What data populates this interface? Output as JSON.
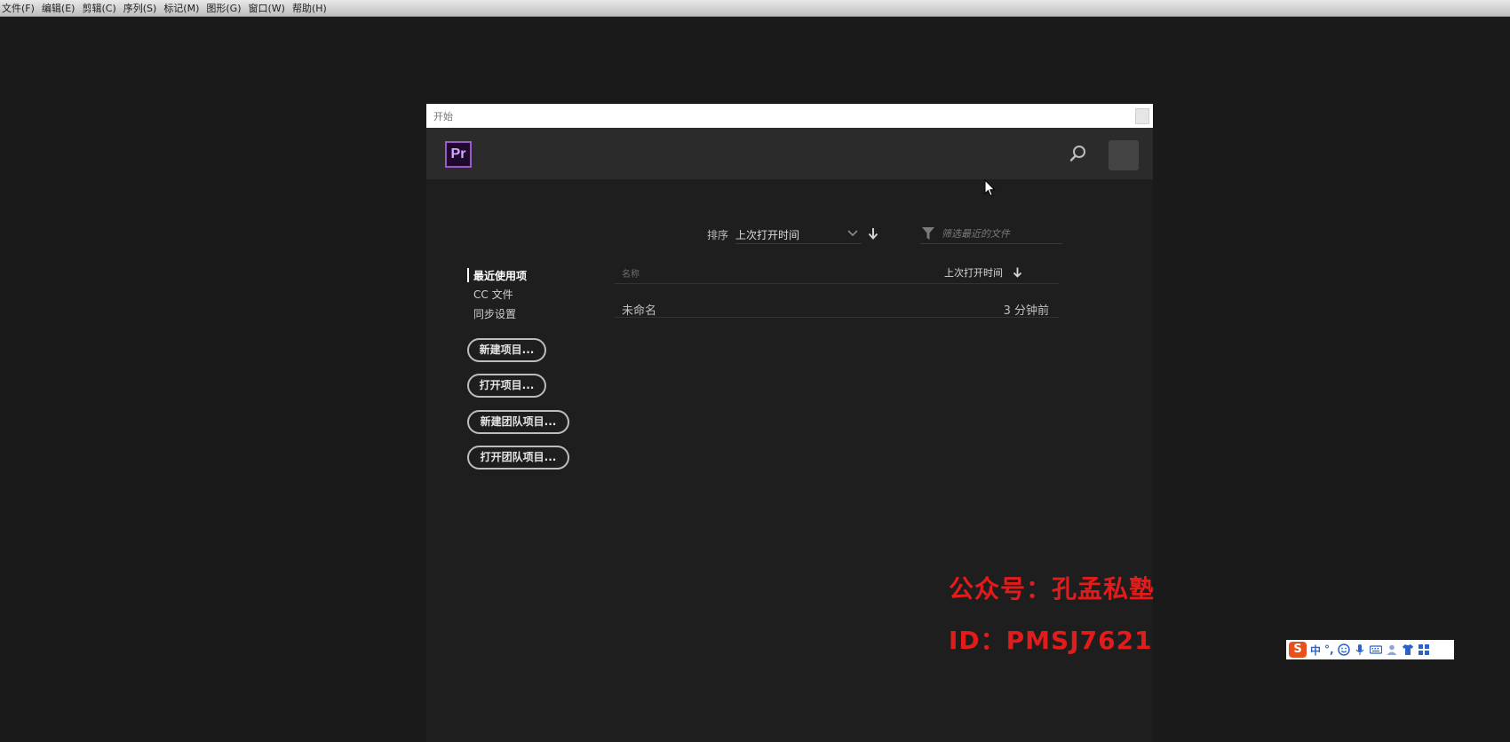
{
  "menubar": {
    "items": [
      "文件(F)",
      "编辑(E)",
      "剪辑(C)",
      "序列(S)",
      "标记(M)",
      "图形(G)",
      "窗口(W)",
      "帮助(H)"
    ]
  },
  "dialog": {
    "title": "开始",
    "logo_text": "Pr",
    "sort": {
      "label": "排序",
      "value": "上次打开时间"
    },
    "filter": {
      "placeholder": "筛选最近的文件"
    },
    "nav": {
      "items": [
        "最近使用项",
        "CC 文件",
        "同步设置"
      ],
      "active_index": 0
    },
    "buttons": {
      "new_project": "新建项目...",
      "open_project": "打开项目...",
      "new_team_project": "新建团队项目...",
      "open_team_project": "打开团队项目..."
    },
    "table": {
      "columns": [
        "名称",
        "上次打开时间"
      ],
      "rows": [
        {
          "name": "未命名",
          "opened": "3 分钟前"
        }
      ]
    }
  },
  "watermark": {
    "line1": "公众号：孔孟私塾",
    "line2": "ID：PMSJ7621"
  },
  "ime": {
    "logo": "S",
    "mode": "中",
    "punct": "°,"
  },
  "colors": {
    "background": "#1a1a1a",
    "dialog": "#1e1e1e",
    "header": "#2b2b2b",
    "pr_accent": "#9b5ac7",
    "watermark": "#e21b1b"
  }
}
